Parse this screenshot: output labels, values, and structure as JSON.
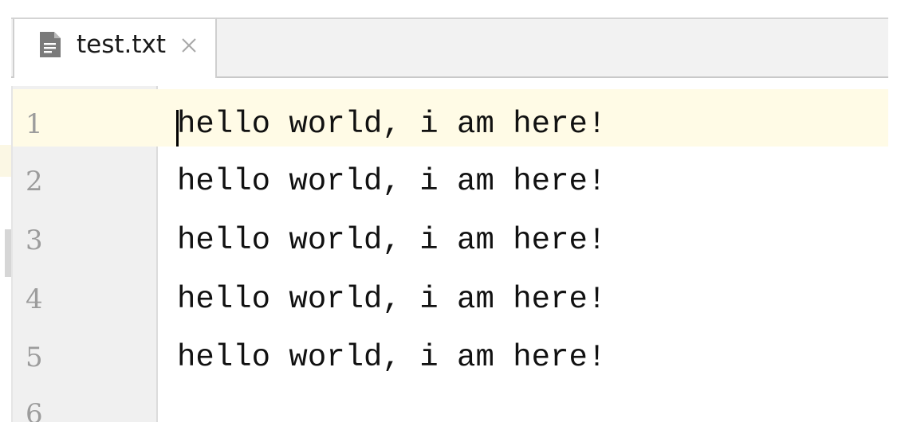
{
  "editor": {
    "tab": {
      "title": "test.txt",
      "icon": "text-file-icon",
      "close_icon": "close-icon"
    },
    "lines": [
      {
        "number": "1",
        "text": "hello world, i am here!"
      },
      {
        "number": "2",
        "text": "hello world, i am here!"
      },
      {
        "number": "3",
        "text": "hello world, i am here!"
      },
      {
        "number": "4",
        "text": "hello world, i am here!"
      },
      {
        "number": "5",
        "text": "hello world, i am here!"
      },
      {
        "number": "6",
        "text": ""
      }
    ],
    "current_line": "1"
  },
  "colors": {
    "current_line_bg": "#fffbe6",
    "gutter_bg": "#f0f0f0",
    "line_number": "#9c9c9c",
    "text": "#111111"
  }
}
